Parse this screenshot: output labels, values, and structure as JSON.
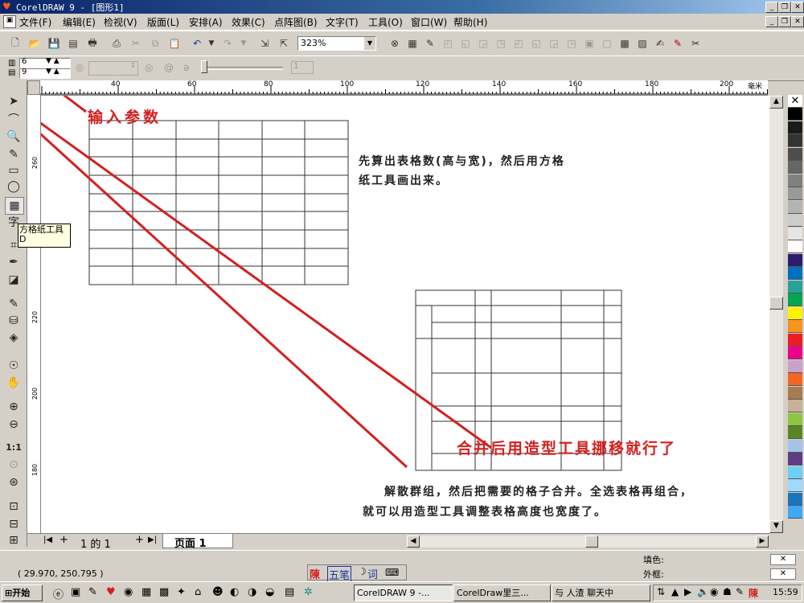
{
  "window": {
    "title": "CorelDRAW 9 - [图形1]"
  },
  "menu": [
    "文件(F)",
    "编辑(E)",
    "检视(V)",
    "版面(L)",
    "安排(A)",
    "效果(C)",
    "点阵图(B)",
    "文字(T)",
    "工具(O)",
    "窗口(W)",
    "帮助(H)"
  ],
  "toolbar": {
    "zoom_value": "323%"
  },
  "property_bar": {
    "rows_value": "6",
    "cols_value": "9",
    "slider_value": "1"
  },
  "ruler": {
    "h_ticks": [
      "40",
      "60",
      "80",
      "100",
      "120",
      "140",
      "160",
      "180",
      "200"
    ],
    "unit": "毫米",
    "v_ticks": [
      "260",
      "240",
      "220",
      "200",
      "180"
    ]
  },
  "tooltip": {
    "title": "方格纸工具",
    "shortcut": "D"
  },
  "annotations": {
    "input_params": "输入参数",
    "step1_line1": "先算出表格数(高与宽)，然后用方格",
    "step1_line2": "纸工具画出来。",
    "merge_title": "合并后用造型工具挪移就行了",
    "step2_line1": "解散群组，然后把需要的格子合并。全选表格再组合，",
    "step2_line2": "就可以用造型工具调整表格高度也宽度了。"
  },
  "page_nav": {
    "page_count": "1 的 1",
    "page_tab": "页面 1"
  },
  "status": {
    "coords": "( 29.970, 250.795 )",
    "fill_label": "填色:",
    "outline_label": "外框:"
  },
  "ime": {
    "brand": "陳",
    "mode": "五笔",
    "punct": "词"
  },
  "taskbar": {
    "start": "开始",
    "tasks": [
      "CorelDRAW 9 -...",
      "CorelDraw里三...",
      "与 人渣 聊天中"
    ],
    "clock": "15:59"
  },
  "palette": [
    "#ffffff",
    "#000000",
    "#1a1a1a",
    "#333333",
    "#4d4d4d",
    "#666666",
    "#808080",
    "#999999",
    "#b3b3b3",
    "#cccccc",
    "#e6e6e6",
    "#ffffff",
    "#2e1a6e",
    "#0070c0",
    "#2aa198",
    "#00a651",
    "#fff200",
    "#f7941d",
    "#ed1c24",
    "#ec008c",
    "#c8a2c8",
    "#f26522",
    "#a67c52",
    "#c7b299",
    "#8dc63f",
    "#598527",
    "#a3c4e6",
    "#5f3b86",
    "#6dcff6",
    "#9fd9ff",
    "#1b75bc",
    "#3fa9f5"
  ]
}
